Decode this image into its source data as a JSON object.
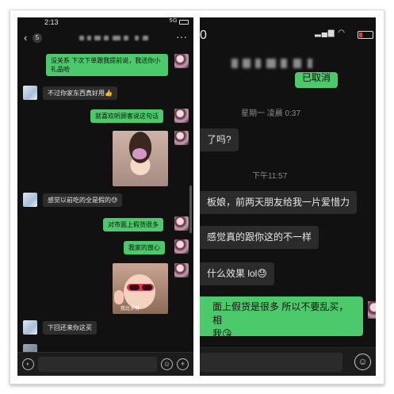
{
  "left": {
    "status": {
      "time": "2:13",
      "signal": "5G"
    },
    "header": {
      "back_glyph": "‹",
      "unread_count": "5",
      "more_glyph": "···"
    },
    "messages": [
      {
        "side": "me",
        "text": "没关系 下次下单跟我提前说，我送你小礼品哈"
      },
      {
        "side": "them",
        "text": "不过你家东西真好用👍"
      },
      {
        "side": "me",
        "text": "就喜欢听顾客说这句话"
      },
      {
        "side": "me",
        "type": "image"
      },
      {
        "side": "them",
        "text": "感觉以前吃的全是假的😓"
      },
      {
        "side": "me",
        "text": "对市面上假货很多"
      },
      {
        "side": "me",
        "text": "我家的放心"
      },
      {
        "side": "me",
        "type": "image",
        "caption": "我比手势"
      },
      {
        "side": "them",
        "text": "下回还来你这买"
      }
    ]
  },
  "right": {
    "status": {
      "time": "0",
      "signal": "▂▄▆ ◠"
    },
    "messages": [
      {
        "side": "me",
        "text": "已取消"
      },
      {
        "type": "timestamp",
        "text": "星期一 凌晨 0:37"
      },
      {
        "side": "them",
        "text": "了吗?"
      },
      {
        "type": "timestamp",
        "text": "下午11:57"
      },
      {
        "side": "them",
        "text": "板娘，前两天朋友给我一片爱惜力"
      },
      {
        "side": "them",
        "text": "感觉真的跟你这的不一样"
      },
      {
        "side": "them",
        "text": "什么效果 lol😓"
      },
      {
        "side": "me",
        "text": "面上假货是很多 所以不要乱买，相"
      },
      {
        "side": "me",
        "text": "我😘"
      }
    ]
  },
  "icons": {
    "voice": "voice-icon",
    "emoji": "emoji-icon",
    "plus": "plus-icon"
  }
}
